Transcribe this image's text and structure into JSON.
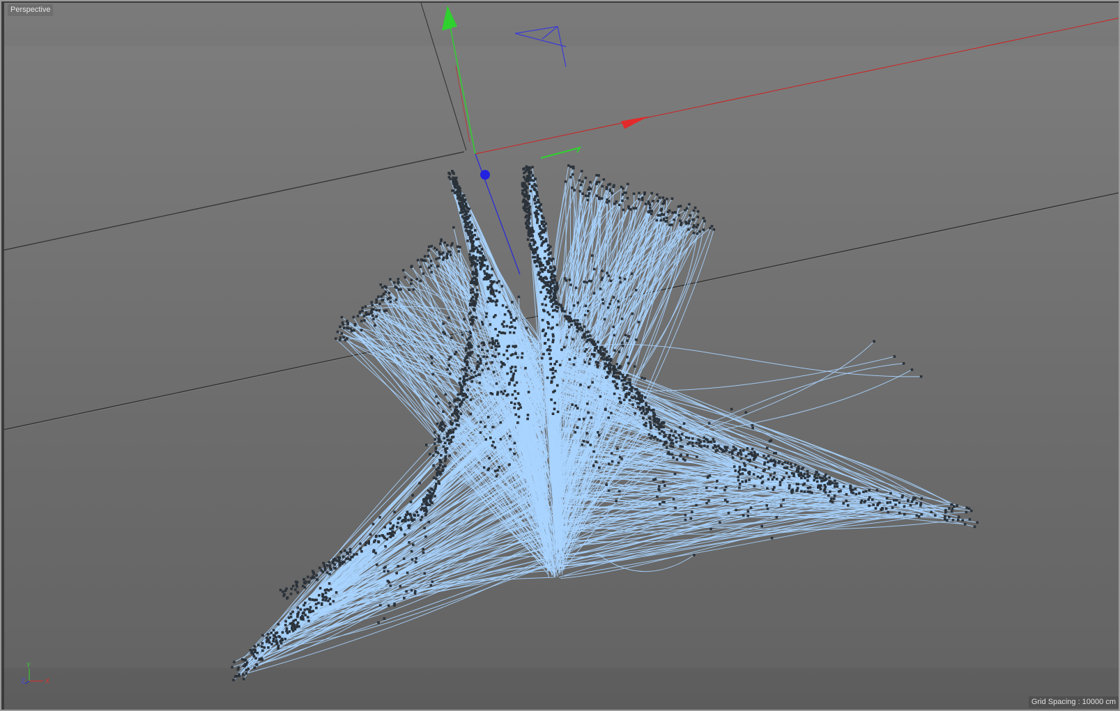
{
  "viewport": {
    "title": "Perspective",
    "grid_spacing": "Grid Spacing : 10000 cm"
  },
  "axis_gizmo": {
    "y_label": "Y",
    "z_label": "Z",
    "x_label": "X"
  },
  "icons": {
    "move_handle": "move-manipulator-icon",
    "camera": "camera-object-icon"
  },
  "colors": {
    "x_axis": "#e22a2a",
    "y_axis": "#2fd12f",
    "z_axis": "#2626e0",
    "splines": "#a9d4ff",
    "points": "#2b323a",
    "horizon_line": "#2e2e2e"
  }
}
